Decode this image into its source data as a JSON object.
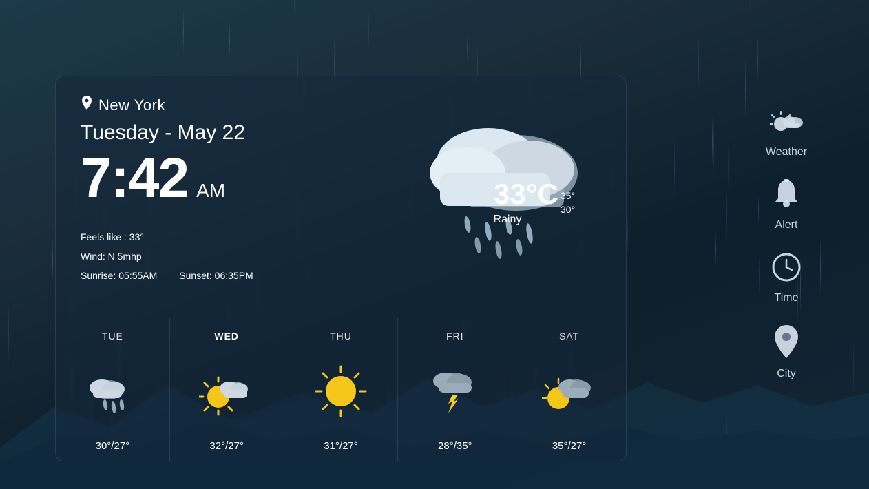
{
  "background": {
    "color_start": "#1c3a4a",
    "color_end": "#0d1f2d"
  },
  "card": {
    "location_icon": "📍",
    "location": "New York",
    "date": "Tuesday - May 22",
    "time": "7:42",
    "ampm": "AM",
    "feels_like": "Feels like : 33°",
    "wind": "Wind: N 5mhp",
    "sunrise": "Sunrise: 05:55AM",
    "sunset": "Sunset: 06:35PM",
    "temperature": "33°C",
    "temp_high": "35°",
    "temp_low": "30°",
    "condition": "Rainy"
  },
  "forecast": [
    {
      "day": "TUE",
      "bold": false,
      "icon": "rainy",
      "temp": "30°/27°"
    },
    {
      "day": "WED",
      "bold": true,
      "icon": "partly-sunny",
      "temp": "32°/27°"
    },
    {
      "day": "THU",
      "bold": false,
      "icon": "sunny",
      "temp": "31°/27°"
    },
    {
      "day": "FRI",
      "bold": false,
      "icon": "stormy",
      "temp": "28°/35°"
    },
    {
      "day": "SAT",
      "bold": false,
      "icon": "partly-cloudy",
      "temp": "35°/27°"
    }
  ],
  "sidebar": [
    {
      "id": "weather",
      "icon": "partly-cloud-sun",
      "label": "Weather"
    },
    {
      "id": "alert",
      "icon": "bell",
      "label": "Alert"
    },
    {
      "id": "time",
      "icon": "clock",
      "label": "Time"
    },
    {
      "id": "city",
      "icon": "pin",
      "label": "City"
    }
  ]
}
